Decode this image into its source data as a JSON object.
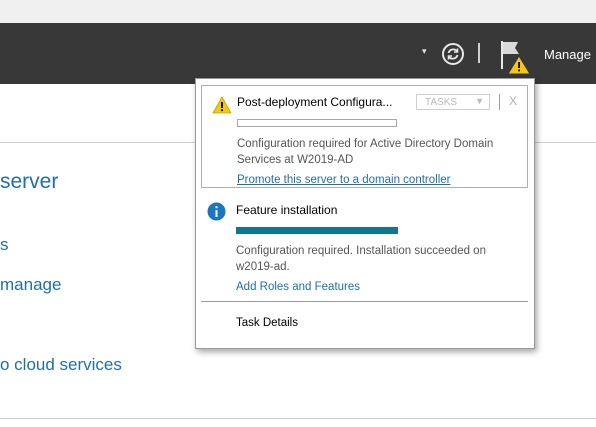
{
  "toolbar": {
    "dropdown_glyph": "▾",
    "refresh_icon": "refresh-icon",
    "flag_icon": "notifications-flag-icon",
    "manage_label": "Manage"
  },
  "background": {
    "title": "server",
    "links": [
      "s",
      "manage",
      "",
      "o cloud services"
    ]
  },
  "notifications": {
    "post_deployment": {
      "title": "Post-deployment Configura...",
      "tasks_label": "TASKS",
      "close_label": "X",
      "progress": 0,
      "message": "Configuration required for Active Directory Domain Services at W2019-AD",
      "link": "Promote this server to a domain controller",
      "icon": "warning-icon"
    },
    "feature_installation": {
      "title": "Feature installation",
      "progress": 1.0,
      "message": "Configuration required. Installation succeeded on w2019-ad.",
      "link": "Add Roles and Features",
      "icon": "info-icon"
    },
    "task_details_label": "Task Details"
  },
  "colors": {
    "titlebar": "#383838",
    "accent_link": "#1f6faa",
    "progress_fill": "#0e7890",
    "warning": "#f2c811"
  }
}
